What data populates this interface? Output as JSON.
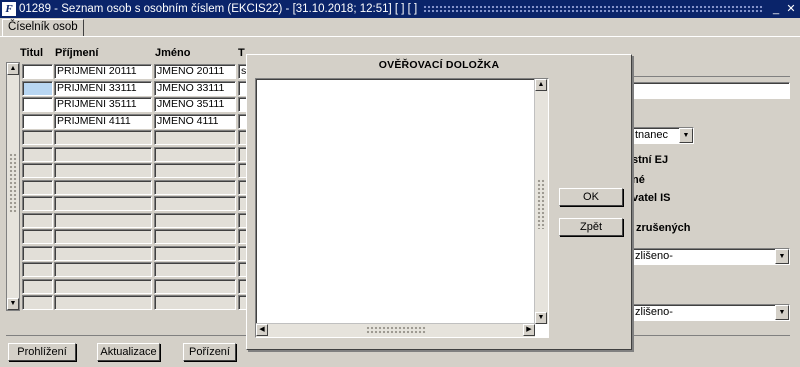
{
  "window": {
    "title": "01289 - Seznam osob s osobním číslem (EKCIS22) - [31.10.2018; 12:51] [ ] [ ]",
    "app_icon": "F"
  },
  "tab": {
    "label": "Číselník osob"
  },
  "table": {
    "headers": {
      "titul": "Titul",
      "prijmeni": "Příjmení",
      "jmeno": "Jméno",
      "t": "T"
    },
    "rows": [
      {
        "titul": "",
        "prijmeni": "PRIJMENI 20111",
        "jmeno": "JMENO 20111",
        "t": "s"
      },
      {
        "titul": "",
        "prijmeni": "PRIJMENI 33111",
        "jmeno": "JMENO 33111",
        "t": ""
      },
      {
        "titul": "",
        "prijmeni": "PRIJMENI 35111",
        "jmeno": "JMENO 35111",
        "t": ""
      },
      {
        "titul": "",
        "prijmeni": "PRIJMENI 4111",
        "jmeno": "JMENO 4111",
        "t": ""
      }
    ]
  },
  "right": {
    "type_select": "tnanec",
    "labels": {
      "ej": "stní EJ",
      "ne": "né",
      "is": "vatel IS",
      "zrusenych": "zrušených"
    },
    "select1": "zlišeno-",
    "select2": "zlišeno-"
  },
  "buttons": {
    "prohlizeni": "Prohlížení",
    "aktualizace": "Aktualizace",
    "porizeni": "Pořízení"
  },
  "modal": {
    "title": "OVĚŘOVACÍ DOLOŽKA",
    "text": "",
    "ok": "OK",
    "zpet": "Zpět"
  }
}
